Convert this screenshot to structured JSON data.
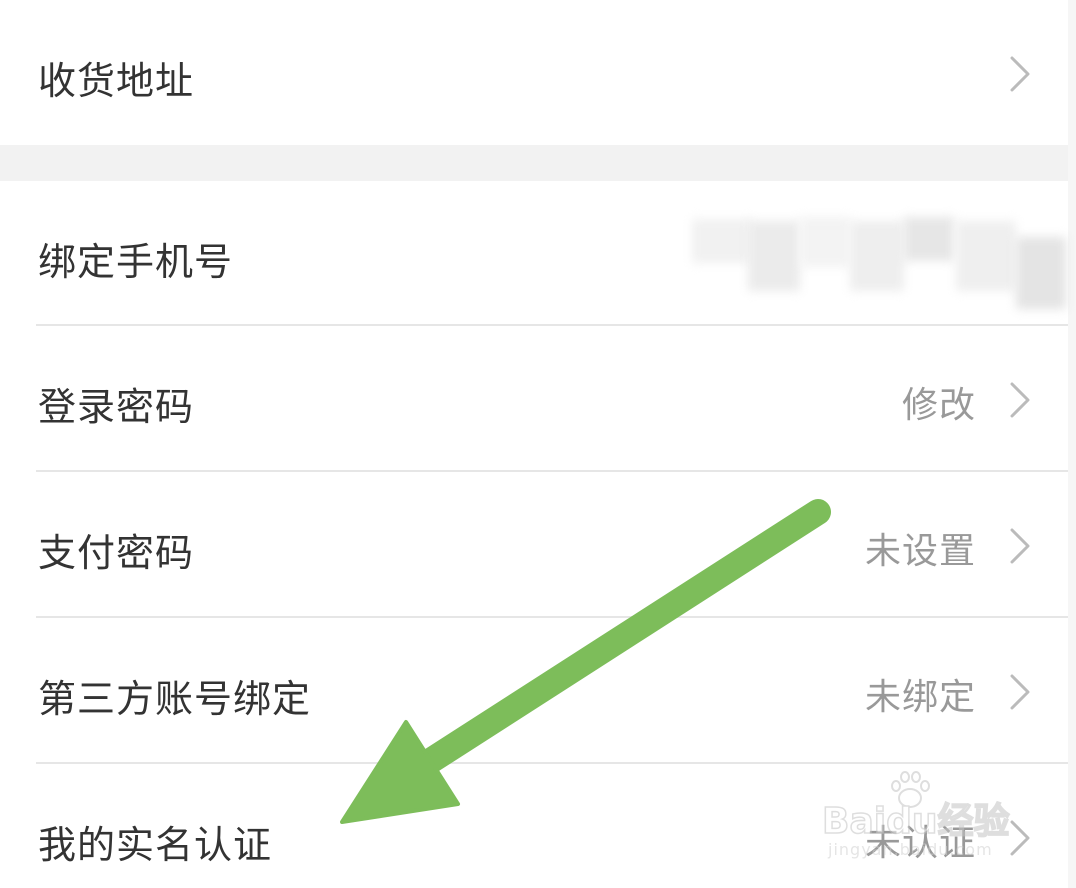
{
  "settings": {
    "address": {
      "label": "收货地址"
    },
    "phone": {
      "label": "绑定手机号"
    },
    "login_password": {
      "label": "登录密码",
      "value": "修改"
    },
    "pay_password": {
      "label": "支付密码",
      "value": "未设置"
    },
    "third_party": {
      "label": "第三方账号绑定",
      "value": "未绑定"
    },
    "real_name": {
      "label": "我的实名认证",
      "value": "未认证"
    }
  },
  "watermark": {
    "brand": "Baidu经验",
    "url": "jingyan.baidu.com"
  },
  "colors": {
    "label": "#333333",
    "value": "#999999",
    "chevron": "#bbbbbb",
    "divider": "#e6e6e6",
    "section_bg": "#f2f2f2",
    "arrow": "#7dbd5a"
  },
  "icons": {
    "row_arrow": "chevron-right-icon",
    "annotation": "green-arrow-annotation"
  }
}
